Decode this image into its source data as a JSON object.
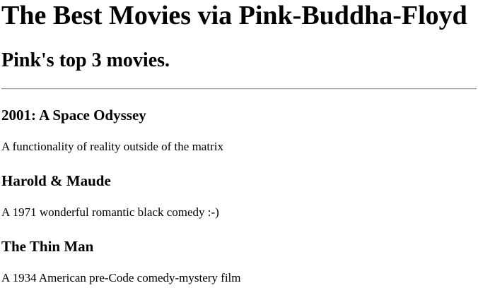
{
  "header": {
    "title": "The Best Movies via Pink-Buddha-Floyd",
    "subtitle": "Pink's top 3 movies."
  },
  "movies": [
    {
      "title": "2001: A Space Odyssey",
      "description": "A functionality of reality outside of the matrix"
    },
    {
      "title": "Harold & Maude",
      "description": "A 1971 wonderful romantic black comedy :-)"
    },
    {
      "title": "The Thin Man",
      "description": "A 1934 American pre-Code comedy-mystery film"
    }
  ]
}
